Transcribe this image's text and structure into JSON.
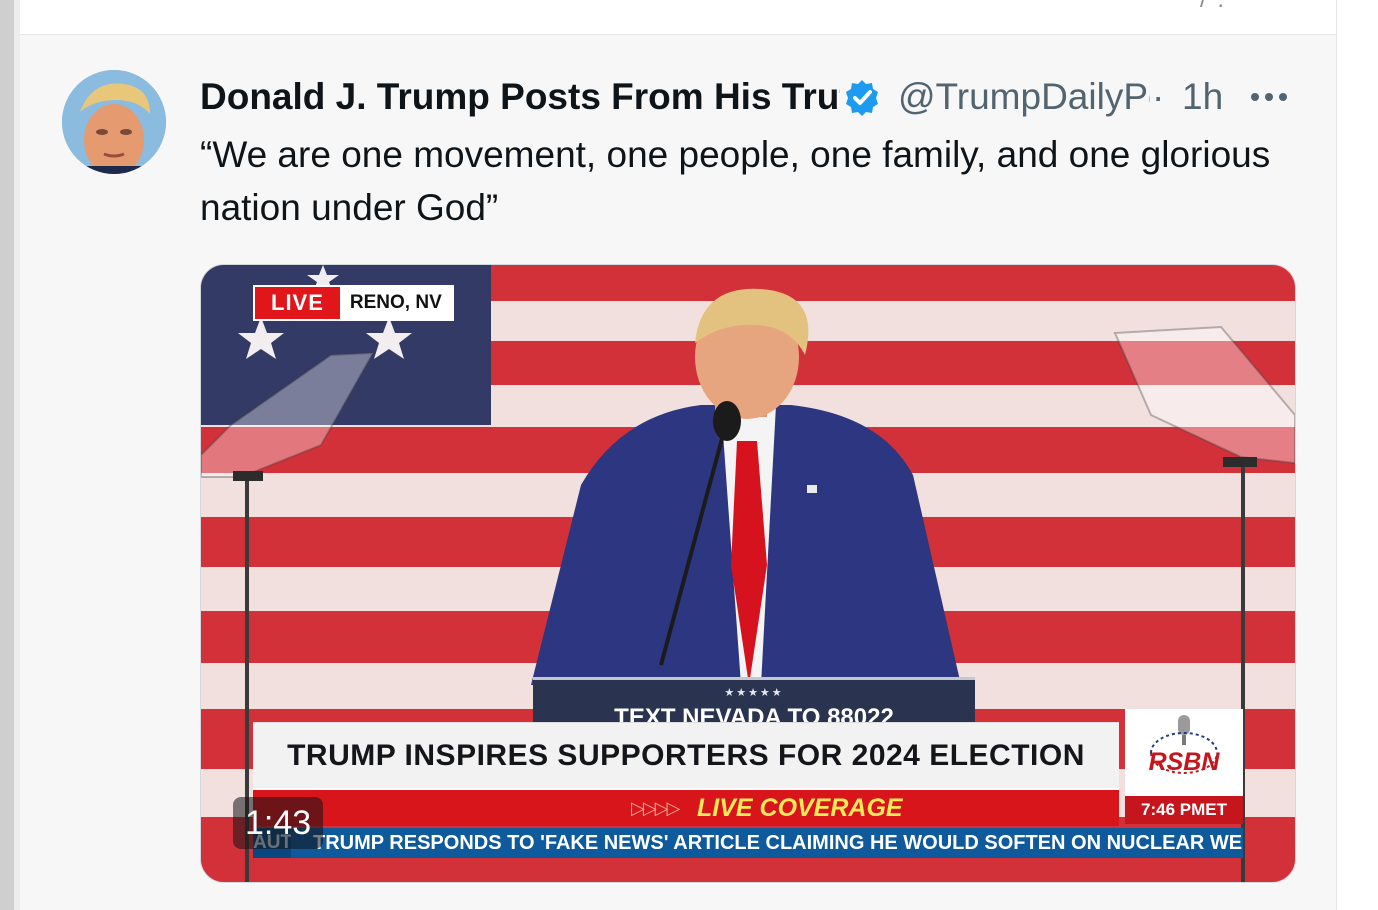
{
  "previous_post": {
    "truncated_hint": "/ ."
  },
  "post": {
    "author": {
      "display_name": "Donald J. Trump Posts From His Truth Social",
      "handle": "@TrumpDailyPosts",
      "verified": true,
      "avatar_icon": "avatar-portrait"
    },
    "separator": "·",
    "time": "1h",
    "more_icon": "more-horizontal-icon",
    "text": "“We are one movement, one people, one family, and one glorious nation under God”",
    "media": {
      "type": "video",
      "duration": "1:43",
      "overlay": {
        "live_label": "LIVE",
        "location": "RENO, NV",
        "podium_stars": "★★★★★",
        "podium_text": "TEXT NEVADA TO 88022",
        "headline": "TRUMP INSPIRES SUPPORTERS FOR 2024 ELECTION",
        "coverage_arrows": "▷▷▷▷",
        "coverage_label": "LIVE COVERAGE",
        "brand_name": "RSBN",
        "brand_time": "7:46 PMET",
        "ticker_edge": "AUT",
        "ticker_text": "TRUMP RESPONDS TO 'FAKE NEWS' ARTICLE CLAIMING HE WOULD SOFTEN ON NUCLEAR WE"
      }
    }
  },
  "colors": {
    "verified_badge": "#1d9bf0",
    "live_red": "#e0161b",
    "ticker_blue": "#0e5a9c",
    "coverage_yellow": "#ffe85a"
  }
}
